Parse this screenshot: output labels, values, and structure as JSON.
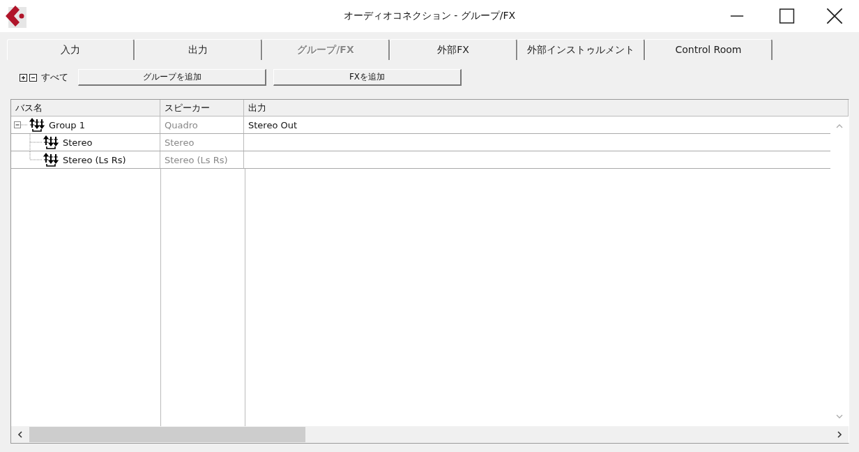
{
  "window": {
    "title": "オーディオコネクション - グループ/FX"
  },
  "tabs": [
    {
      "label": "入力",
      "selected": false
    },
    {
      "label": "出力",
      "selected": false
    },
    {
      "label": "グループ/FX",
      "selected": true
    },
    {
      "label": "外部FX",
      "selected": false
    },
    {
      "label": "外部インストゥルメント",
      "selected": false
    },
    {
      "label": "Control Room",
      "selected": false
    }
  ],
  "toolbar": {
    "all_label": "すべて",
    "buttons": [
      "グループを追加",
      "FXを追加"
    ]
  },
  "table": {
    "columns": [
      "バス名",
      "スピーカー",
      "出力"
    ],
    "rows": [
      {
        "name": "Group 1",
        "speaker": "Quadro",
        "output": "Stereo Out",
        "expanded": true,
        "children": [
          {
            "name": "Stereo",
            "speaker": "Stereo"
          },
          {
            "name": "Stereo (Ls Rs)",
            "speaker": "Stereo (Ls Rs)"
          }
        ]
      }
    ]
  }
}
